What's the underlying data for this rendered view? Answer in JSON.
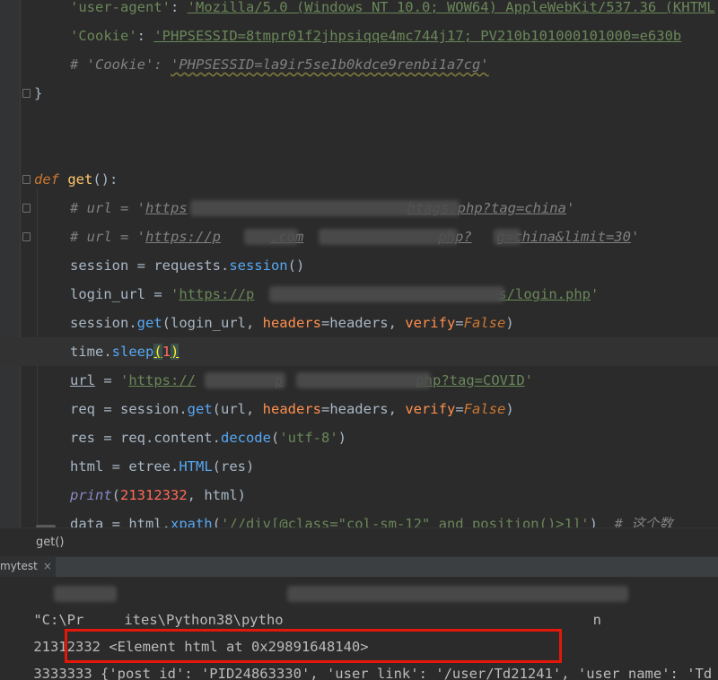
{
  "editor": {
    "lines": {
      "l1_key": "'user-agent'",
      "l1_colon": ": ",
      "l1_val": "'Mozilla/5.0 (Windows NT 10.0; WOW64) AppleWebKit/537.36 (KHTML",
      "l2_key": "'Cookie'",
      "l2_colon": ": ",
      "l2_val": "'PHPSESSID=8tmpr01f2jhpsiqqe4mc744j17; PV210b101000101000=e630b",
      "l3_prefix": "# ",
      "l3_key": "'Cookie'",
      "l3_colon": ": ",
      "l3_val": "'PHPSESSID=la9ir5se1b0kdce9renbi1a7cg'",
      "l4": "}",
      "l7_def": "def",
      "l7_name": "get",
      "l7_rest": "():",
      "l8_cmt": "# url = '",
      "l8_url1": "https",
      "l8_url2": "htags.php?tag=china",
      "l8_end": "'",
      "l9_cmt": "# url = '",
      "l9_url1": "https://p",
      "l9_url2": ".com",
      "l9_url3": "php?",
      "l9_url4": "g=china&limit=30",
      "l9_end": "'",
      "l10_a": "session = requests.",
      "l10_b": "session",
      "l10_c": "()",
      "l11_a": "login_url = ",
      "l11_q": "'",
      "l11_u1": "https://p",
      "l11_u2": "s/login.php",
      "l11_e": "'",
      "l12_a": "session.",
      "l12_get": "get",
      "l12_b": "(login_url, ",
      "l12_p1": "headers",
      "l12_c": "=headers, ",
      "l12_p2": "verify",
      "l12_d": "=",
      "l12_f": "False",
      "l12_e": ")",
      "l13_a": "time.",
      "l13_fn": "sleep",
      "l13_open": "(",
      "l13_num": "1",
      "l13_close": ")",
      "l14_a": "url",
      "l14_b": " = ",
      "l14_q": "'",
      "l14_u1": "https://",
      "l14_u2": "p",
      "l14_u3": "php?tag=COVID",
      "l14_e": "'",
      "l15_a": "req = session.",
      "l15_get": "get",
      "l15_b": "(url, ",
      "l15_p1": "headers",
      "l15_c": "=headers, ",
      "l15_p2": "verify",
      "l15_d": "=",
      "l15_f": "False",
      "l15_e": ")",
      "l16_a": "res = req.content.",
      "l16_fn": "decode",
      "l16_b": "(",
      "l16_s": "'utf-8'",
      "l16_c": ")",
      "l17_a": "html = etree.",
      "l17_fn": "HTML",
      "l17_b": "(res)",
      "l18_fn": "print",
      "l18_b": "(",
      "l18_num": "21312332",
      "l18_c": ", html)",
      "l19_a": "data = html.",
      "l19_fn": "xpath",
      "l19_b": "(",
      "l19_s": "'//div[@class=\"col-sm-12\" and position()>1]'",
      "l19_c": ")  ",
      "l19_cmt": "# 这个数"
    }
  },
  "breadcrumb": {
    "label": "get()"
  },
  "run_panel": {
    "tab_label": "mytest",
    "close_glyph": "×",
    "lines": {
      "c1_a": "\"C:\\Pr",
      "c1_b": "ites\\Python38\\pytho",
      "c1_c": "n",
      "c2": "21312332 <Element html at 0x29891648140>",
      "c3_prefix": "3333333 ",
      "c3_hl": "{'post_id': 'PID24863330', 'user_link': '/user/Td21241'",
      "c3_rest": ", 'user_name': 'Td"
    }
  },
  "colors": {
    "background": "#2b2b2b",
    "keyword": "#cc7832",
    "string": "#6a8759",
    "number": "#6897bb",
    "highlight_box": "#e3170a"
  }
}
